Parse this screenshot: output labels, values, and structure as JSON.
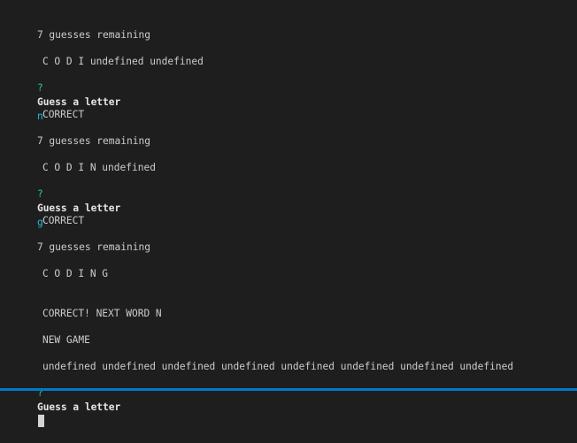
{
  "colors": {
    "background": "#1e1e1e",
    "text": "#cccccc",
    "question_mark": "#23d18b",
    "answer": "#29b8db",
    "status_bar": "#007acc"
  },
  "icons": {
    "cursor": "block-cursor-icon"
  },
  "terminal": {
    "lines": [
      {
        "text": "7 guesses remaining"
      },
      {
        "text": "C O D I undefined undefined"
      },
      {
        "qmark": "?",
        "label": "Guess a letter",
        "answer": "n"
      },
      {
        "text": "CORRECT"
      },
      {
        "text": "7 guesses remaining"
      },
      {
        "text": "C O D I N undefined"
      },
      {
        "qmark": "?",
        "label": "Guess a letter",
        "answer": "g"
      },
      {
        "text": "CORRECT"
      },
      {
        "text": "7 guesses remaining"
      },
      {
        "text": "C O D I N G"
      },
      {
        "text": "CORRECT! NEXT WORD N"
      },
      {
        "text": "NEW GAME"
      },
      {
        "text": "undefined undefined undefined undefined undefined undefined undefined undefined"
      },
      {
        "qmark": "?",
        "label": "Guess a letter"
      }
    ]
  }
}
